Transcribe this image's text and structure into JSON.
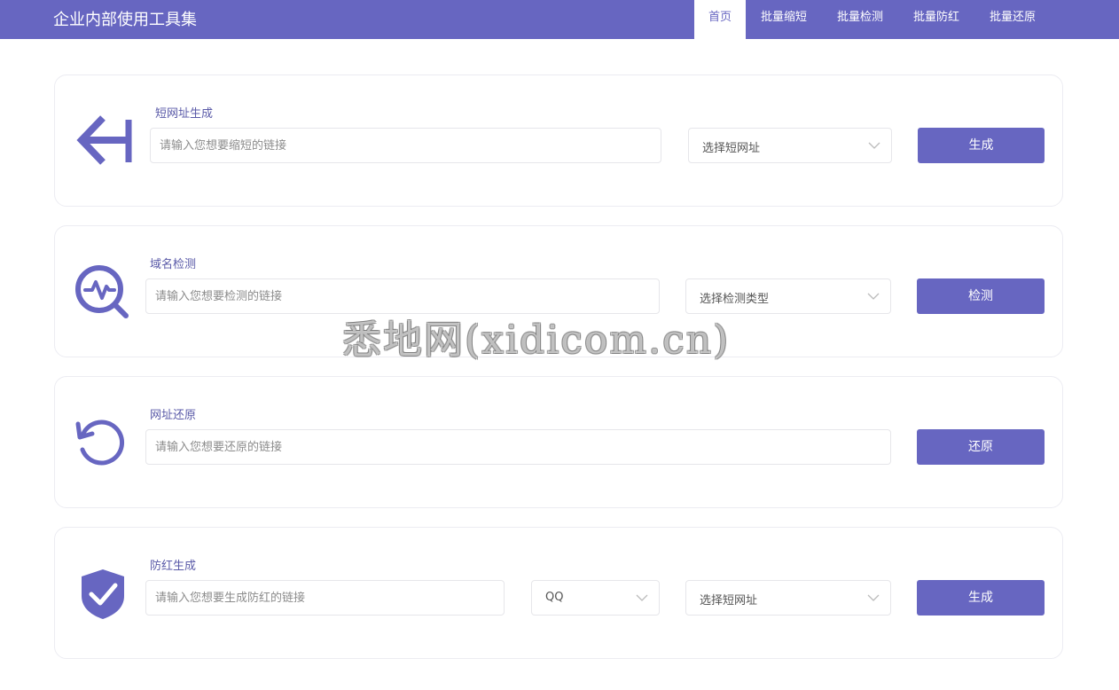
{
  "app": {
    "title": "企业内部使用工具集"
  },
  "nav": {
    "home": "首页",
    "batch_shorten": "批量缩短",
    "batch_check": "批量检测",
    "batch_antiblock": "批量防红",
    "batch_restore": "批量还原",
    "active": "home"
  },
  "cards": {
    "shorten": {
      "title": "短网址生成",
      "placeholder": "请输入您想要缩短的链接",
      "select": "选择短网址",
      "button": "生成",
      "icon": "arrow-left-bar-icon"
    },
    "check": {
      "title": "域名检测",
      "placeholder": "请输入您想要检测的链接",
      "select": "选择检测类型",
      "button": "检测",
      "icon": "search-pulse-icon"
    },
    "restore": {
      "title": "网址还原",
      "placeholder": "请输入您想要还原的链接",
      "button": "还原",
      "icon": "restore-icon"
    },
    "antiblock": {
      "title": "防红生成",
      "placeholder": "请输入您想要生成防红的链接",
      "platform_select": "QQ",
      "select": "选择短网址",
      "button": "生成",
      "icon": "shield-check-icon"
    }
  },
  "watermark": "悉地网(xidicom.cn)",
  "colors": {
    "accent": "#6766c1",
    "title": "#5a5aa8",
    "border": "#e6e6ea",
    "background": "#ffffff"
  }
}
